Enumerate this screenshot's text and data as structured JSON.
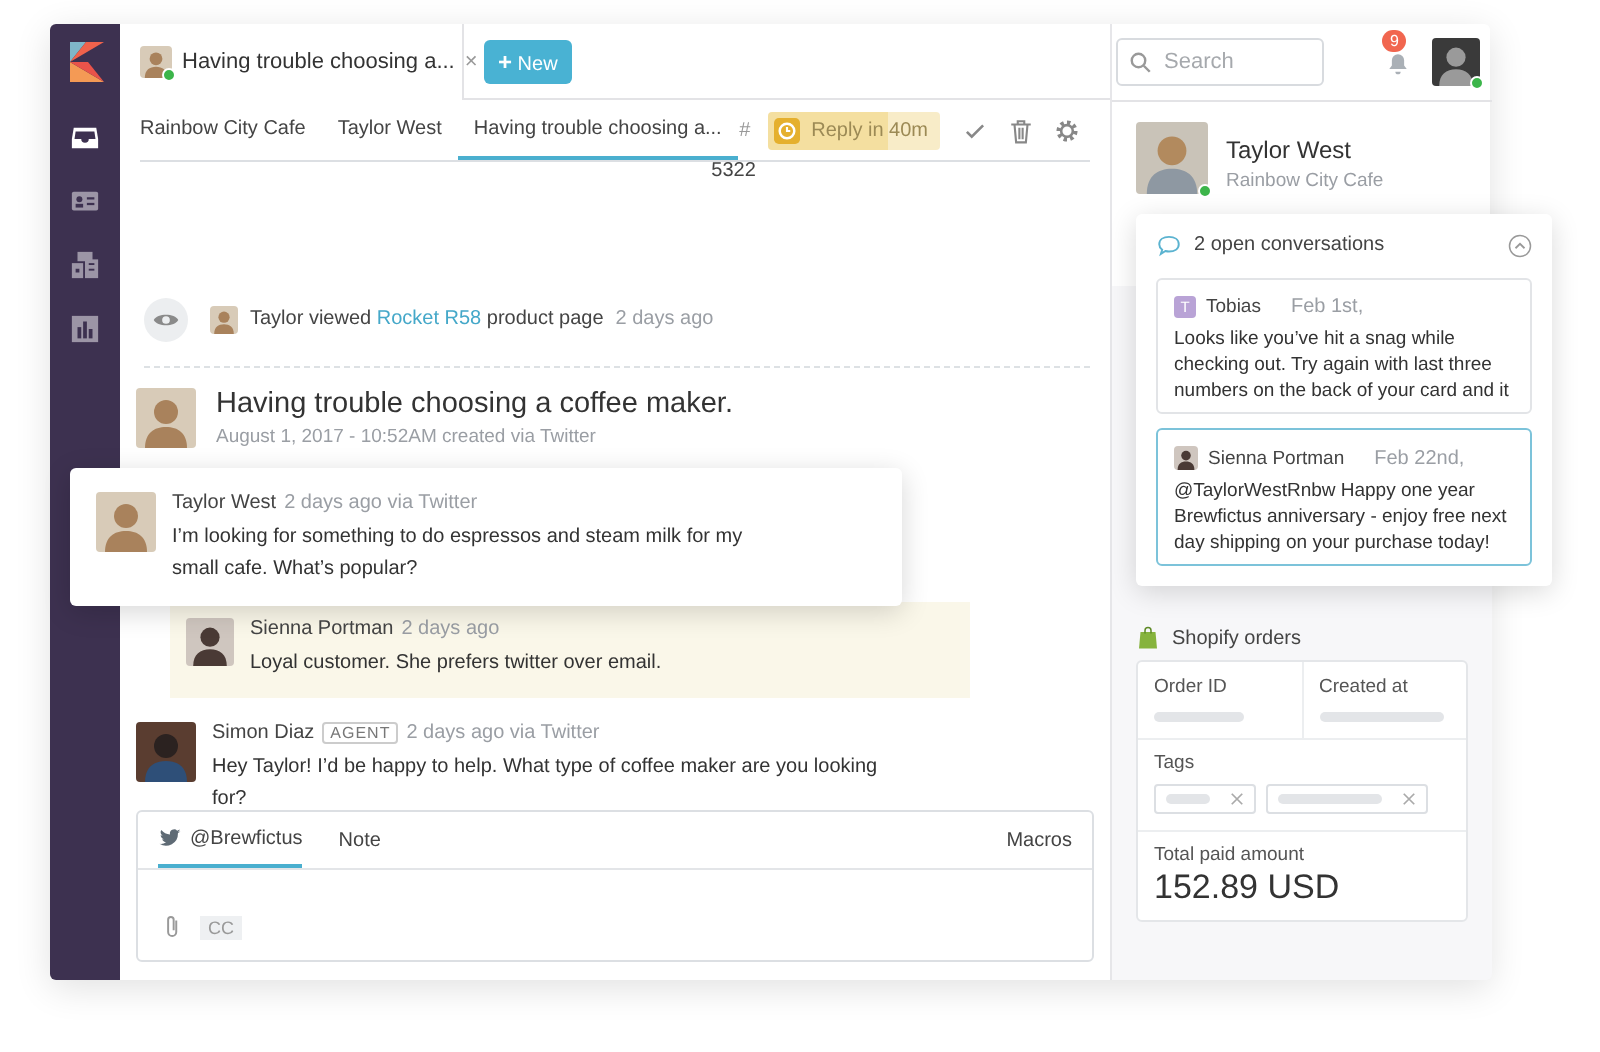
{
  "nav": [
    {
      "kind": "inbox",
      "selected": true
    },
    {
      "kind": "contacts",
      "selected": false
    },
    {
      "kind": "companies",
      "selected": false
    },
    {
      "kind": "reports",
      "selected": false
    }
  ],
  "open_tab": {
    "title": "Having trouble choosing a...",
    "close": "×",
    "online": true
  },
  "new_button": {
    "icon": "+",
    "label": "New"
  },
  "search": {
    "placeholder": "Search"
  },
  "notifications": {
    "count": "9"
  },
  "breadcrumbs": [
    {
      "label": "Rainbow City Cafe",
      "selected": false
    },
    {
      "label": "Taylor West",
      "selected": false
    },
    {
      "label": "Having trouble choosing a...",
      "selected": true
    }
  ],
  "ticket": {
    "hash": "#",
    "number": "5322"
  },
  "reply_timer": "Reply in 40m",
  "activity": {
    "text": "Taylor viewed",
    "link": "Rocket R58",
    "rest": "product page",
    "time": "2 days ago"
  },
  "conversation": {
    "title": "Having trouble choosing a coffee maker.",
    "meta": "August 1, 2017 - 10:52AM created via Twitter"
  },
  "messages": [
    {
      "kind": "customer",
      "author": "Taylor West",
      "time": "2 days ago via Twitter",
      "text": "I’m looking for something to do espressos and steam milk for my small cafe. What’s popular?"
    },
    {
      "kind": "note",
      "author": "Sienna Portman",
      "time": "2 days ago",
      "text": "Loyal customer. She prefers twitter over email."
    },
    {
      "kind": "agent",
      "author": "Simon Diaz",
      "badge": "AGENT",
      "time": "2 days ago via Twitter",
      "text": "Hey Taylor! I’d be happy to help. What type of coffee maker are you looking for?"
    }
  ],
  "composer": {
    "tabs": [
      {
        "kind": "twitter",
        "label": "@Brewfictus",
        "selected": true
      },
      {
        "kind": "note",
        "label": "Note",
        "selected": false
      }
    ],
    "macros": "Macros",
    "cc": "CC"
  },
  "contact": {
    "name": "Taylor West",
    "company": "Rainbow City Cafe",
    "online": true
  },
  "open_conversations": {
    "title": "2 open conversations",
    "items": [
      {
        "kind": "initial",
        "initial": "T",
        "author": "Tobias",
        "date": "Feb 1st,",
        "text": "Looks like you’ve hit a snag while checking out. Try again with last three numbers on the back of your card and it",
        "selected": false
      },
      {
        "kind": "avatar",
        "author": "Sienna Portman",
        "date": "Feb 22nd,",
        "text": "@TaylorWestRnbw Happy one year Brewfictus anniversary - enjoy free next day shipping on your purchase today!",
        "selected": true
      }
    ]
  },
  "shopify": {
    "title": "Shopify orders",
    "fields": [
      "Order ID",
      "Created at"
    ],
    "tags_label": "Tags",
    "total_label": "Total paid amount",
    "total": "152.89 USD"
  }
}
